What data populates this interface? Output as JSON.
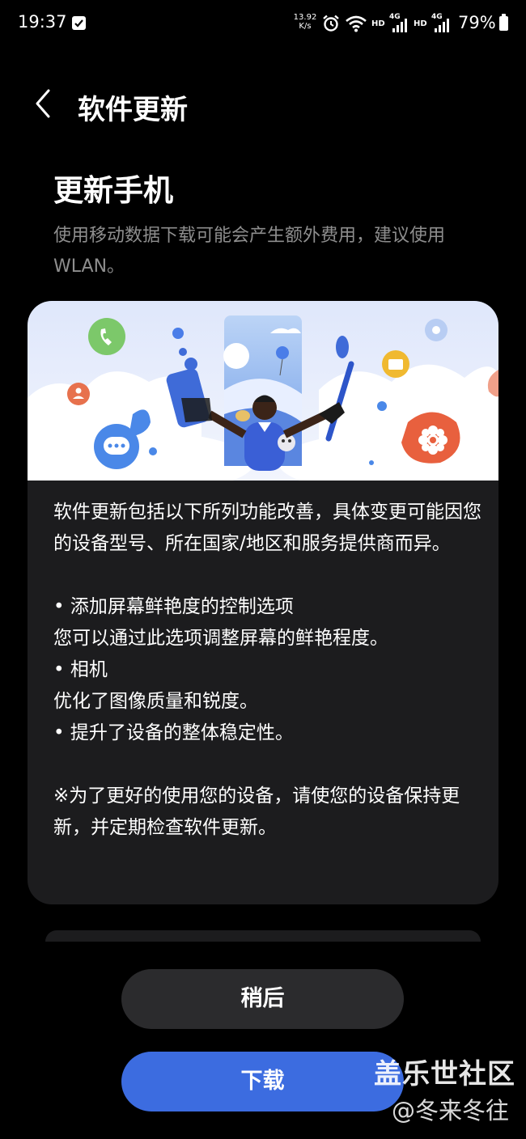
{
  "status_bar": {
    "time": "19:37",
    "net_speed_value": "13.92",
    "net_speed_unit": "K/s",
    "hd_label": "HD",
    "net_type": "4G",
    "battery": "79%"
  },
  "header": {
    "title": "软件更新"
  },
  "main": {
    "heading": "更新手机",
    "subtitle": "使用移动数据下载可能会产生额外费用，建议使用 WLAN。"
  },
  "card": {
    "intro": "软件更新包括以下所列功能改善，具体变更可能因您的设备型号、所在国家/地区和服务提供商而异。",
    "items": [
      "• 添加屏幕鲜艳度的控制选项",
      "您可以通过此选项调整屏幕的鲜艳程度。",
      "• 相机",
      "优化了图像质量和锐度。",
      "• 提升了设备的整体稳定性。"
    ],
    "note": "※为了更好的使用您的设备，请使您的设备保持更新，并定期检查软件更新。"
  },
  "buttons": {
    "later": "稍后",
    "download": "下载"
  },
  "watermark": {
    "line1": "盖乐世社区",
    "line2": "@冬来冬往"
  },
  "colors": {
    "background": "#000000",
    "card": "#1c1c1e",
    "primary_button": "#3c6ce0",
    "secondary_button": "#2b2b2d",
    "subtitle_text": "#8e8e8e"
  }
}
